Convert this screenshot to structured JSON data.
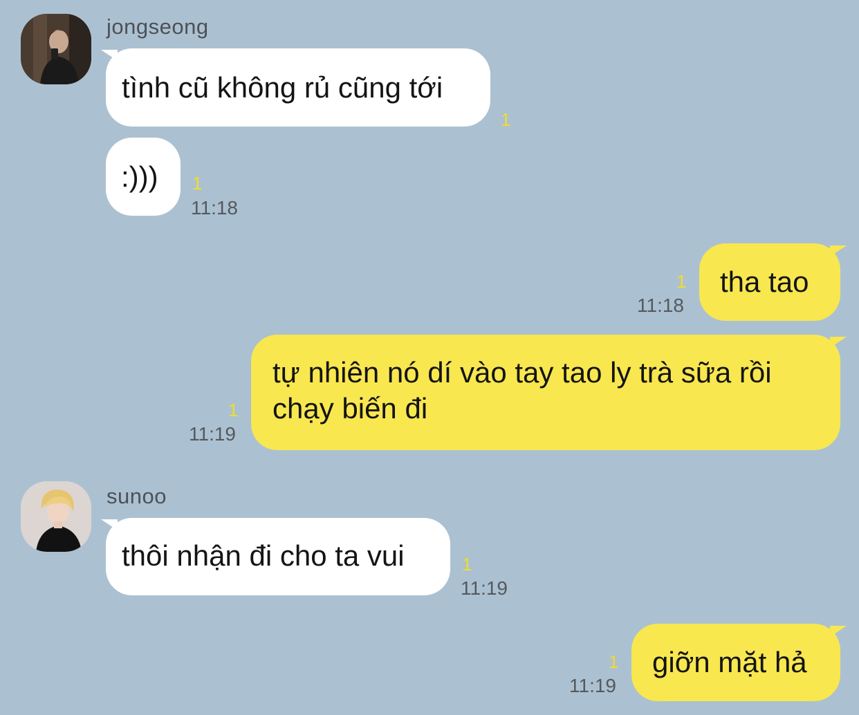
{
  "theme": {
    "background": "#abc1d1",
    "incoming_bubble": "#ffffff",
    "outgoing_bubble": "#f8e74f",
    "unread_color": "#f2dc2a"
  },
  "messages": [
    {
      "sender": "jongseong",
      "direction": "incoming",
      "text": "tình cũ không rủ cũng tới",
      "unread": "1"
    },
    {
      "direction": "incoming",
      "text": ":)))",
      "unread": "1",
      "time": "11:18"
    },
    {
      "direction": "outgoing",
      "text": "tha tao",
      "unread": "1",
      "time": "11:18"
    },
    {
      "direction": "outgoing",
      "text_line1": "tự nhiên nó dí vào tay tao ly trà sữa rồi",
      "text_line2": "chạy biến đi",
      "unread": "1",
      "time": "11:19"
    },
    {
      "sender": "sunoo",
      "direction": "incoming",
      "text": "thôi nhận đi cho ta vui",
      "unread": "1",
      "time": "11:19"
    },
    {
      "direction": "outgoing",
      "text": "giỡn mặt hả",
      "unread": "1",
      "time": "11:19"
    }
  ],
  "avatars": {
    "jongseong": "avatar-dark-mirror-selfie",
    "sunoo": "avatar-blond-black-outfit"
  }
}
